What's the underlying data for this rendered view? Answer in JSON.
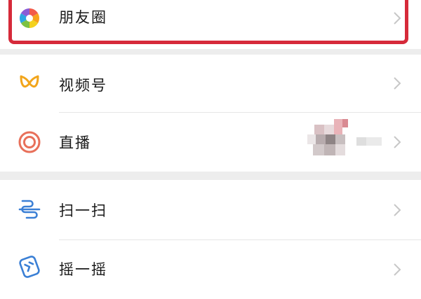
{
  "highlight_color": "#d62a3a",
  "items": [
    {
      "key": "moments",
      "label": "朋友圈",
      "icon": "moments-aperture-icon"
    },
    {
      "key": "channels",
      "label": "视频号",
      "icon": "channels-butterfly-icon"
    },
    {
      "key": "live",
      "label": "直播",
      "icon": "live-ring-icon"
    },
    {
      "key": "scan",
      "label": "扫一扫",
      "icon": "scan-icon"
    },
    {
      "key": "shake",
      "label": "摇一摇",
      "icon": "shake-icon"
    }
  ]
}
